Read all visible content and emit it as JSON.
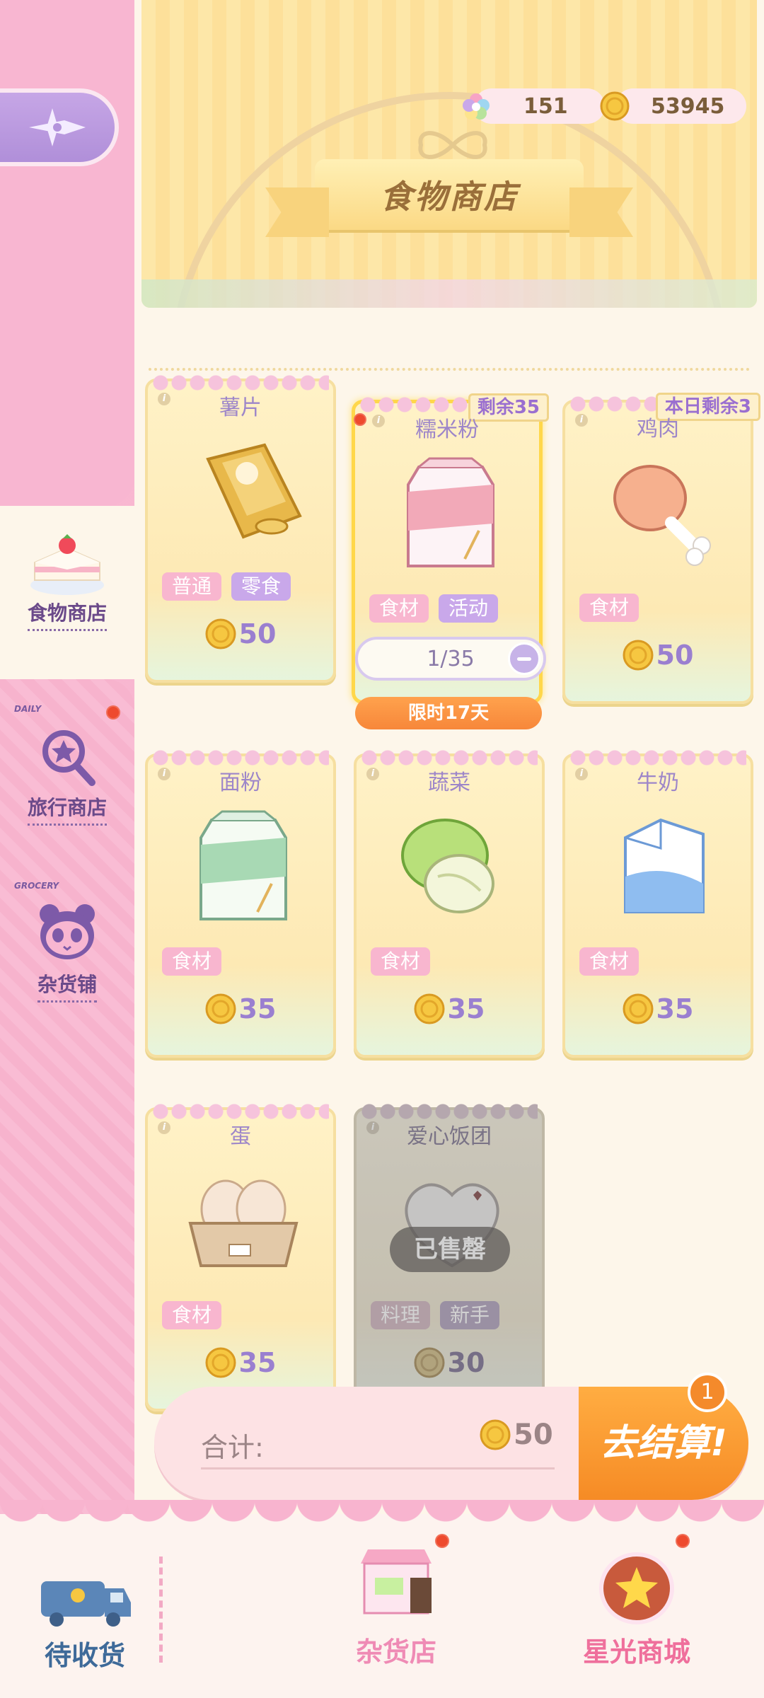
{
  "header": {
    "title": "食物商店",
    "currency": [
      {
        "name": "star-gem",
        "value": "151",
        "icon": "rainbow-star-icon"
      },
      {
        "name": "gold-coin",
        "value": "53945",
        "icon": "coin-icon"
      }
    ]
  },
  "sidebar": {
    "back_icon": "compass-arrow-icon",
    "items": [
      {
        "label": "食物商店",
        "icon": "strawberry-cake-icon",
        "active": true
      },
      {
        "label": "旅行商店",
        "tag": "DAILY",
        "icon": "magnifier-star-icon",
        "dot": true
      },
      {
        "label": "杂货铺",
        "tag": "GROCERY",
        "icon": "panda-icon"
      }
    ]
  },
  "items": [
    {
      "name": "薯片",
      "tags": [
        "普通",
        "零食"
      ],
      "price": "50",
      "icon": "chips-bag-icon"
    },
    {
      "name": "糯米粉",
      "tags": [
        "食材",
        "活动"
      ],
      "price": "",
      "icon": "rice-flour-bag-icon",
      "badge": "剩余35",
      "qty": "1/35",
      "timer": "限时17天",
      "selected": true
    },
    {
      "name": "鸡肉",
      "tags": [
        "食材"
      ],
      "price": "50",
      "icon": "chicken-leg-icon",
      "badge": "本日剩余3"
    },
    {
      "name": "面粉",
      "tags": [
        "食材"
      ],
      "price": "35",
      "icon": "flour-bag-icon"
    },
    {
      "name": "蔬菜",
      "tags": [
        "食材"
      ],
      "price": "35",
      "icon": "cabbage-icon"
    },
    {
      "name": "牛奶",
      "tags": [
        "食材"
      ],
      "price": "35",
      "icon": "milk-carton-icon"
    },
    {
      "name": "蛋",
      "tags": [
        "食材"
      ],
      "price": "35",
      "icon": "egg-carton-icon"
    },
    {
      "name": "爱心饭团",
      "tags": [
        "料理",
        "新手"
      ],
      "price": "30",
      "icon": "heart-rice-ball-icon",
      "soldout": "已售罄"
    }
  ],
  "total": {
    "label": "合计:",
    "amount": "50",
    "checkout_label": "去结算!",
    "cart_count": "1"
  },
  "bottom_nav": {
    "pending": "待收货",
    "grocery": "杂货店",
    "starlight": "星光商城"
  },
  "colors": {
    "sidebar_pink": "#f8b6d1",
    "accent_purple": "#9a7fd0",
    "checkout_orange": "#f68b25",
    "card_yellow": "#fff2c7"
  }
}
